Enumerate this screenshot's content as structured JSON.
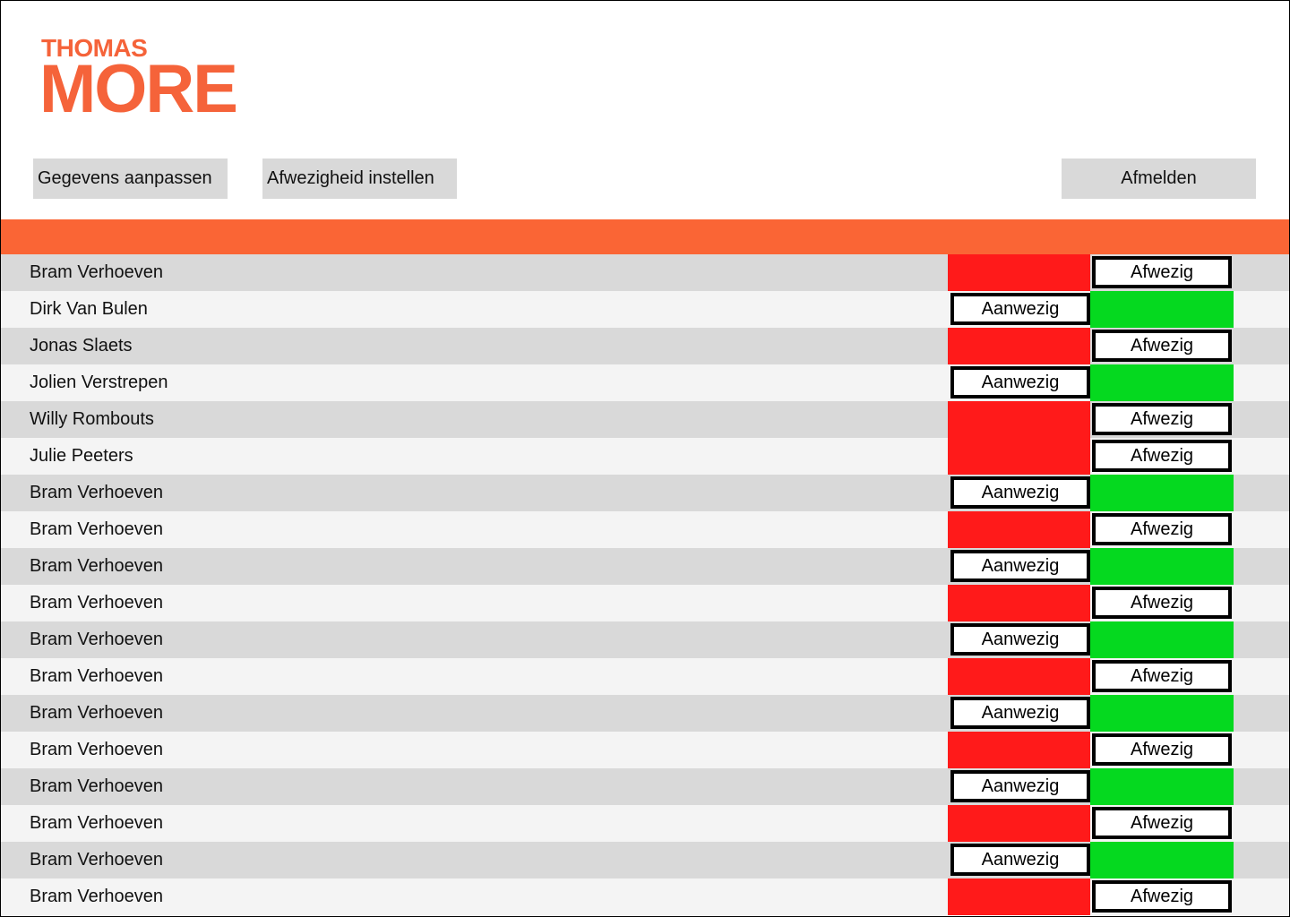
{
  "brand": {
    "line1": "THOMAS",
    "line2": "MORE",
    "color": "#f5633a"
  },
  "nav": {
    "edit_label": "Gegevens aanpassen",
    "absence_label": "Afwezigheid instellen",
    "logout_label": "Afmelden"
  },
  "colors": {
    "accent_bar": "#fa6535",
    "absent": "#ff1a1a",
    "present": "#05d91f"
  },
  "students": [
    {
      "name": "Bram Verhoeven",
      "status": "absent",
      "button": "Afwezig"
    },
    {
      "name": "Dirk Van Bulen",
      "status": "present",
      "button": "Aanwezig"
    },
    {
      "name": "Jonas Slaets",
      "status": "absent",
      "button": "Afwezig"
    },
    {
      "name": "Jolien Verstrepen",
      "status": "present",
      "button": "Aanwezig"
    },
    {
      "name": "Willy Rombouts",
      "status": "absent",
      "button": "Afwezig"
    },
    {
      "name": "Julie Peeters",
      "status": "absent",
      "button": "Afwezig"
    },
    {
      "name": "Bram Verhoeven",
      "status": "present",
      "button": "Aanwezig"
    },
    {
      "name": "Bram Verhoeven",
      "status": "absent",
      "button": "Afwezig"
    },
    {
      "name": "Bram Verhoeven",
      "status": "present",
      "button": "Aanwezig"
    },
    {
      "name": "Bram Verhoeven",
      "status": "absent",
      "button": "Afwezig"
    },
    {
      "name": "Bram Verhoeven",
      "status": "present",
      "button": "Aanwezig"
    },
    {
      "name": "Bram Verhoeven",
      "status": "absent",
      "button": "Afwezig"
    },
    {
      "name": "Bram Verhoeven",
      "status": "present",
      "button": "Aanwezig"
    },
    {
      "name": "Bram Verhoeven",
      "status": "absent",
      "button": "Afwezig"
    },
    {
      "name": "Bram Verhoeven",
      "status": "present",
      "button": "Aanwezig"
    },
    {
      "name": "Bram Verhoeven",
      "status": "absent",
      "button": "Afwezig"
    },
    {
      "name": "Bram Verhoeven",
      "status": "present",
      "button": "Aanwezig"
    },
    {
      "name": "Bram Verhoeven",
      "status": "absent",
      "button": "Afwezig"
    }
  ]
}
